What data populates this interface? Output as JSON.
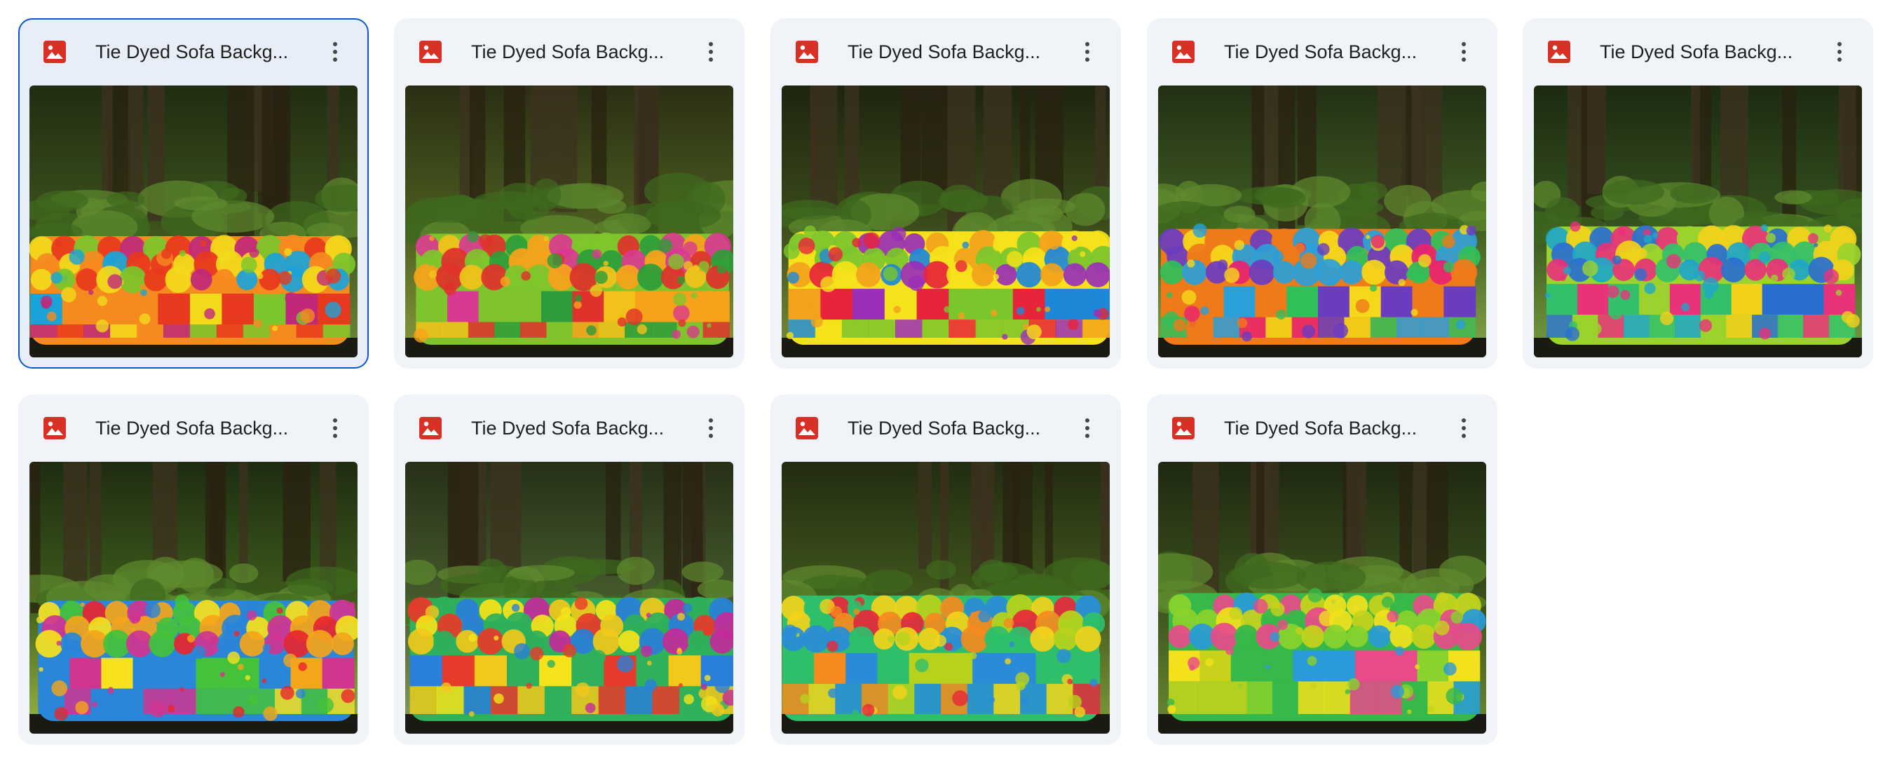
{
  "files": [
    {
      "name": "Tie Dyed Sofa Backg...",
      "type_icon": "image-file-icon",
      "selected": true,
      "forest": [
        "#1f2d12",
        "#3b4f1c",
        "#6d8a3a"
      ],
      "sofa": [
        "#f2d91b",
        "#7bc62d",
        "#1aa3d9",
        "#e8381d",
        "#f58a1f",
        "#c0287a"
      ]
    },
    {
      "name": "Tie Dyed Sofa Backg...",
      "type_icon": "image-file-icon",
      "selected": false,
      "forest": [
        "#2a2f14",
        "#4a5a1e",
        "#8a9a3c"
      ],
      "sofa": [
        "#f7a21b",
        "#e0312b",
        "#d93a8f",
        "#f2c21b",
        "#7fc42d",
        "#2e9c3a"
      ]
    },
    {
      "name": "Tie Dyed Sofa Backg...",
      "type_icon": "image-file-icon",
      "selected": false,
      "forest": [
        "#1e2410",
        "#3a4a1a",
        "#7a8f3a"
      ],
      "sofa": [
        "#e8243a",
        "#f2a31b",
        "#1e88d8",
        "#7ac52c",
        "#f5e21a",
        "#9a2fb8"
      ]
    },
    {
      "name": "Tie Dyed Sofa Backg...",
      "type_icon": "image-file-icon",
      "selected": false,
      "forest": [
        "#223016",
        "#3e5a20",
        "#86a84a"
      ],
      "sofa": [
        "#2a9fd8",
        "#2fc05a",
        "#e8236f",
        "#f5d81b",
        "#ef7a1a",
        "#6a3cc0"
      ]
    },
    {
      "name": "Tie Dyed Sofa Backg...",
      "type_icon": "image-file-icon",
      "selected": false,
      "forest": [
        "#1c2a12",
        "#34501e",
        "#78a040"
      ],
      "sofa": [
        "#1fa6c8",
        "#34c06a",
        "#e8327a",
        "#f2d11b",
        "#9cd22d",
        "#2a6fd0"
      ]
    },
    {
      "name": "Tie Dyed Sofa Backg...",
      "type_icon": "image-file-icon",
      "selected": false,
      "forest": [
        "#1e2c12",
        "#3c5a1a",
        "#9ab848"
      ],
      "sofa": [
        "#e8262e",
        "#f5a51a",
        "#f7e21b",
        "#44c23a",
        "#2a86d8",
        "#d03590"
      ]
    },
    {
      "name": "Tie Dyed Sofa Backg...",
      "type_icon": "image-file-icon",
      "selected": false,
      "forest": [
        "#263018",
        "#445a2c",
        "#8aa060"
      ],
      "sofa": [
        "#c42a9a",
        "#2a7fd8",
        "#f2c81b",
        "#e83a2a",
        "#2fb05a",
        "#f5e31b"
      ]
    },
    {
      "name": "Tie Dyed Sofa Backg...",
      "type_icon": "image-file-icon",
      "selected": false,
      "forest": [
        "#222c12",
        "#40561c",
        "#7f9c3a"
      ],
      "sofa": [
        "#b8d21b",
        "#f58a1f",
        "#e8283a",
        "#2a8cd8",
        "#2fbf6a",
        "#f2d31b"
      ]
    },
    {
      "name": "Tie Dyed Sofa Backg...",
      "type_icon": "image-file-icon",
      "selected": false,
      "forest": [
        "#1e2812",
        "#3a501c",
        "#6e8a34"
      ],
      "sofa": [
        "#8ad22d",
        "#f2e11b",
        "#2a9ad8",
        "#e84a8a",
        "#37b84a",
        "#c8d21b"
      ]
    }
  ]
}
